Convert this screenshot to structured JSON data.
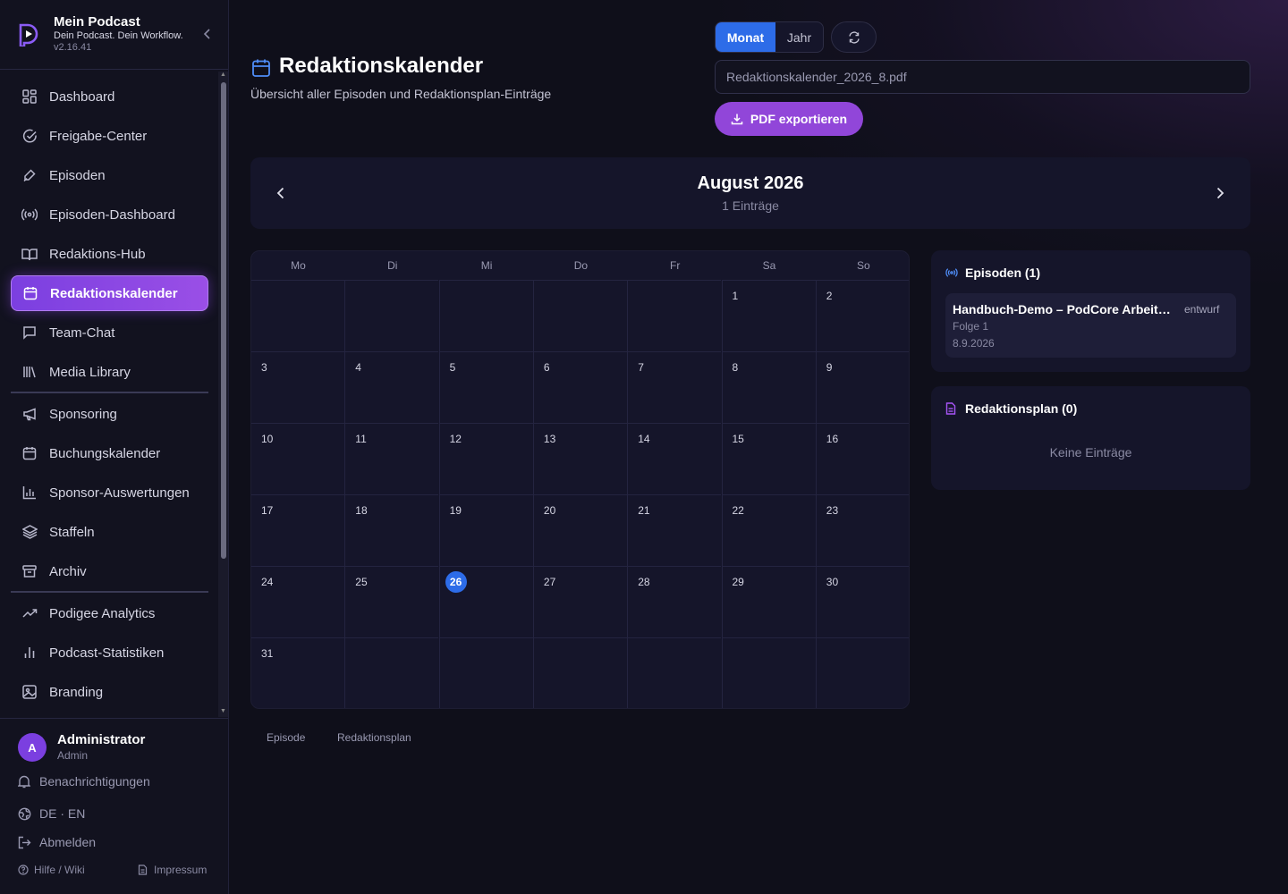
{
  "brand": {
    "title": "Mein Podcast",
    "subtitle": "Dein Podcast. Dein Workflow.",
    "version": "v2.16.41"
  },
  "nav": {
    "items": [
      {
        "label": "Dashboard",
        "icon": "grid-icon"
      },
      {
        "label": "Freigabe-Center",
        "icon": "check-circle-icon"
      },
      {
        "label": "Episoden",
        "icon": "link-icon"
      },
      {
        "label": "Episoden-Dashboard",
        "icon": "broadcast-icon"
      },
      {
        "label": "Redaktions-Hub",
        "icon": "book-icon"
      },
      {
        "label": "Redaktionskalender",
        "icon": "calendar-icon",
        "active": true
      },
      {
        "label": "Team-Chat",
        "icon": "chat-icon"
      },
      {
        "label": "Media Library",
        "icon": "library-icon"
      },
      {
        "label": "Sponsoring",
        "icon": "megaphone-icon"
      },
      {
        "label": "Buchungskalender",
        "icon": "calendar-icon"
      },
      {
        "label": "Sponsor-Auswertungen",
        "icon": "bar-chart-icon"
      },
      {
        "label": "Staffeln",
        "icon": "layers-icon"
      },
      {
        "label": "Archiv",
        "icon": "archive-icon"
      },
      {
        "label": "Podigee Analytics",
        "icon": "trend-icon"
      },
      {
        "label": "Podcast-Statistiken",
        "icon": "stats-icon"
      },
      {
        "label": "Branding",
        "icon": "image-icon"
      }
    ]
  },
  "user": {
    "initial": "A",
    "name": "Administrator",
    "role": "Admin",
    "notifications": "Benachrichtigungen",
    "language": "DE · EN",
    "logout": "Abmelden",
    "help": "Hilfe / Wiki",
    "imprint": "Impressum"
  },
  "header": {
    "title": "Redaktionskalender",
    "subtitle": "Übersicht aller Episoden und Redaktionsplan-Einträge"
  },
  "toolbar": {
    "view_month": "Monat",
    "view_year": "Jahr",
    "filename": "Redaktionskalender_2026_8.pdf",
    "export_label": "PDF exportieren"
  },
  "calendar": {
    "month_title": "August 2026",
    "count_label": "1 Einträge",
    "weekdays": [
      "Mo",
      "Di",
      "Mi",
      "Do",
      "Fr",
      "Sa",
      "So"
    ],
    "weeks": [
      [
        "",
        "",
        "",
        "",
        "",
        "1",
        "2"
      ],
      [
        "3",
        "4",
        "5",
        "6",
        "7",
        "8",
        "9"
      ],
      [
        "10",
        "11",
        "12",
        "13",
        "14",
        "15",
        "16"
      ],
      [
        "17",
        "18",
        "19",
        "20",
        "21",
        "22",
        "23"
      ],
      [
        "24",
        "25",
        "26",
        "27",
        "28",
        "29",
        "30"
      ],
      [
        "31",
        "",
        "",
        "",
        "",
        "",
        ""
      ]
    ],
    "today": "26"
  },
  "episodes_panel": {
    "title": "Episoden (1)",
    "items": [
      {
        "title": "Handbuch-Demo – PodCore Arbeitsablauf",
        "status": "entwurf",
        "folge": "Folge 1",
        "date": "8.9.2026"
      }
    ]
  },
  "plan_panel": {
    "title": "Redaktionsplan (0)",
    "empty": "Keine Einträge"
  },
  "legend": {
    "episode": "Episode",
    "plan": "Redaktionsplan"
  },
  "colors": {
    "accent_blue": "#2d6ce8",
    "accent_purple": "#9146d9",
    "background": "#0f0f1a",
    "panel": "#15152a"
  }
}
